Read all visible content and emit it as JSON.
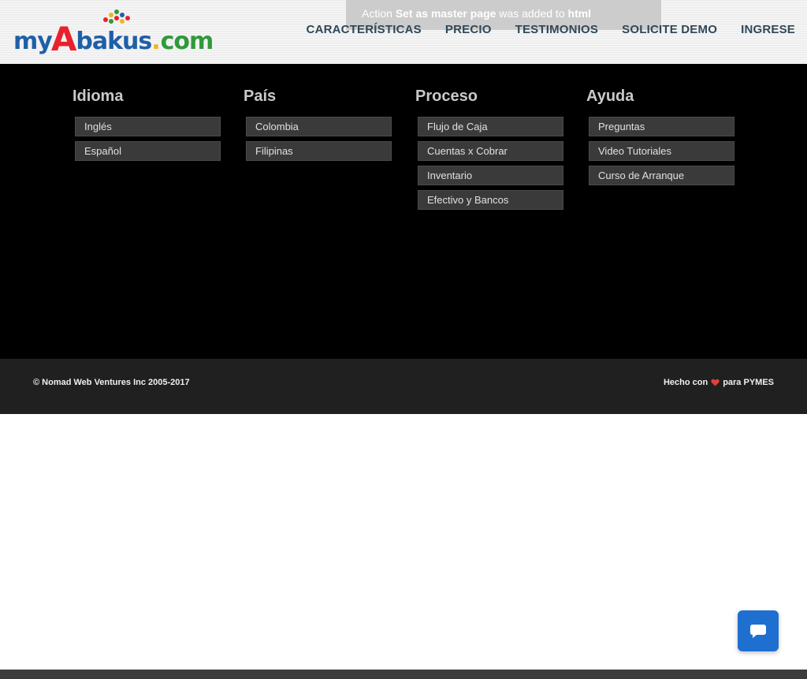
{
  "brand": {
    "logo_my": "my",
    "logo_a": "A",
    "logo_bakus": "bakus",
    "logo_dot": ".",
    "logo_com": "com",
    "colors": {
      "blue": "#1f5fa8",
      "red": "#e8212c",
      "green": "#2e9a3a",
      "yellow": "#f2b41c"
    }
  },
  "toast": {
    "prefix": "Action",
    "action": "Set as master page",
    "middle": "was added to",
    "target": "html"
  },
  "nav": {
    "items": [
      {
        "label": "CARACTERÍSTICAS"
      },
      {
        "label": "PRECIO"
      },
      {
        "label": "TESTIMONIOS"
      },
      {
        "label": "SOLICITE DEMO"
      },
      {
        "label": "INGRESE"
      }
    ]
  },
  "sections": [
    {
      "title": "Idioma",
      "links": [
        "Inglés",
        "Español"
      ]
    },
    {
      "title": "País",
      "links": [
        "Colombia",
        "Filipinas"
      ]
    },
    {
      "title": "Proceso",
      "links": [
        "Flujo de Caja",
        "Cuentas x Cobrar",
        "Inventario",
        "Efectivo y Bancos"
      ]
    },
    {
      "title": "Ayuda",
      "links": [
        "Preguntas",
        "Video Tutoriales",
        "Curso de Arranque"
      ]
    }
  ],
  "footer": {
    "copyright": "© Nomad Web Ventures Inc 2005-2017",
    "made_prefix": "Hecho con",
    "made_suffix": "para PYMES",
    "heart_color": "#e0413a"
  },
  "chat": {
    "icon": "chat-bubble-icon",
    "color": "#1f6fd1"
  }
}
